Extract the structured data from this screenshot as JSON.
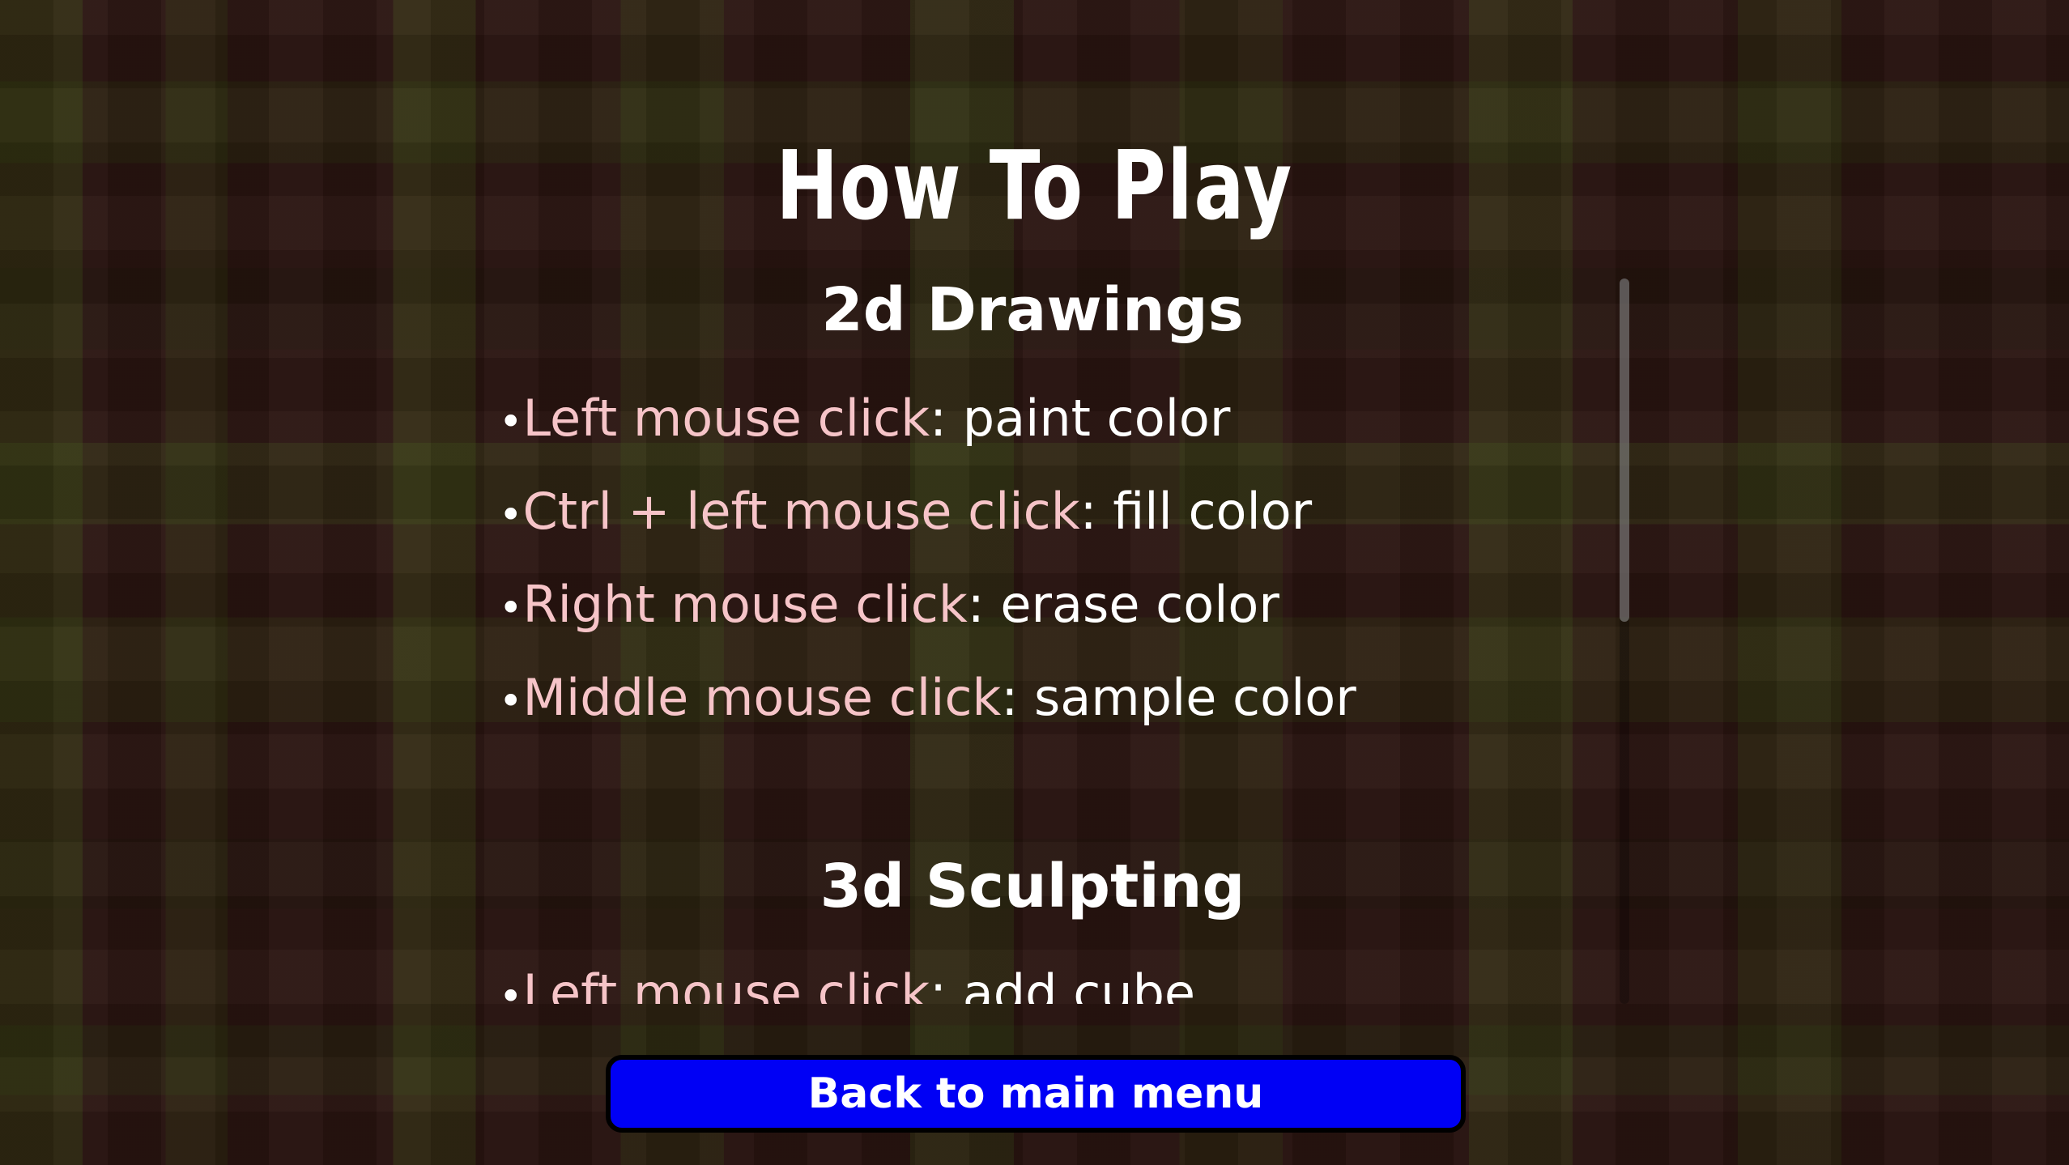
{
  "page": {
    "title": "How To Play"
  },
  "sections": [
    {
      "heading": "2d Drawings",
      "items": [
        {
          "key": "Left mouse click",
          "action": "paint color"
        },
        {
          "key": "Ctrl + left mouse click",
          "action": "fill color"
        },
        {
          "key": "Right mouse click",
          "action": "erase color"
        },
        {
          "key": "Middle mouse click",
          "action": "sample color"
        }
      ]
    },
    {
      "heading": "3d Sculpting",
      "items": [
        {
          "key": "Left mouse click",
          "action": "add cube"
        }
      ]
    }
  ],
  "bullet_char": "•",
  "separator": ": ",
  "footer": {
    "back_label": "Back to main menu"
  },
  "colors": {
    "key_text": "#f6c4c8",
    "button_bg": "#0000f5",
    "text": "#ffffff"
  }
}
